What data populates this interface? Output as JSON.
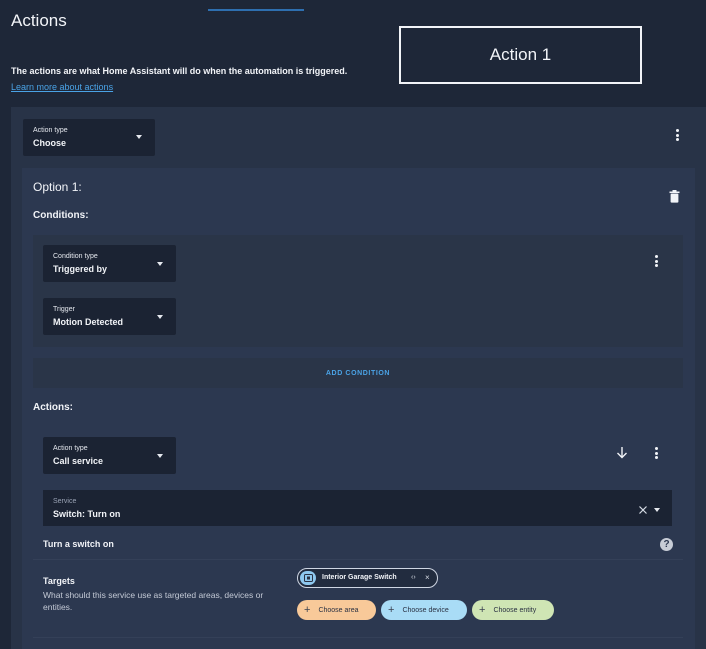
{
  "header": {
    "title": "Actions",
    "action_label": "Action 1",
    "intro": "The actions are what Home Assistant will do when the automation is triggered.",
    "learn_more": "Learn more about actions"
  },
  "action": {
    "type_label": "Action type",
    "type_value": "Choose"
  },
  "option": {
    "title": "Option 1:",
    "conditions_heading": "Conditions:",
    "condition_type_label": "Condition type",
    "condition_type_value": "Triggered by",
    "trigger_label": "Trigger",
    "trigger_value": "Motion Detected",
    "add_condition": "ADD CONDITION",
    "actions_heading": "Actions:",
    "sub_action_type_label": "Action type",
    "sub_action_type_value": "Call service",
    "service_label": "Service",
    "service_value": "Switch: Turn on",
    "service_description": "Turn a switch on",
    "help_glyph": "?",
    "targets_title": "Targets",
    "targets_desc": "What should this service use as targeted areas, devices or entities.",
    "target_entity": "Interior Garage Switch",
    "choose_area": "Choose area",
    "choose_device": "Choose device",
    "choose_entity": "Choose entity"
  },
  "colors": {
    "accent": "#4aa3e6",
    "area_chip": "#f8c999",
    "device_chip": "#a9dcf6",
    "entity_chip": "#cfe5b4"
  },
  "icons": [
    "more-vert-icon",
    "delete-icon",
    "arrow-down-icon",
    "clear-icon",
    "dropdown-icon",
    "help-icon",
    "switch-icon",
    "expand-icon",
    "remove-icon",
    "plus-icon"
  ]
}
